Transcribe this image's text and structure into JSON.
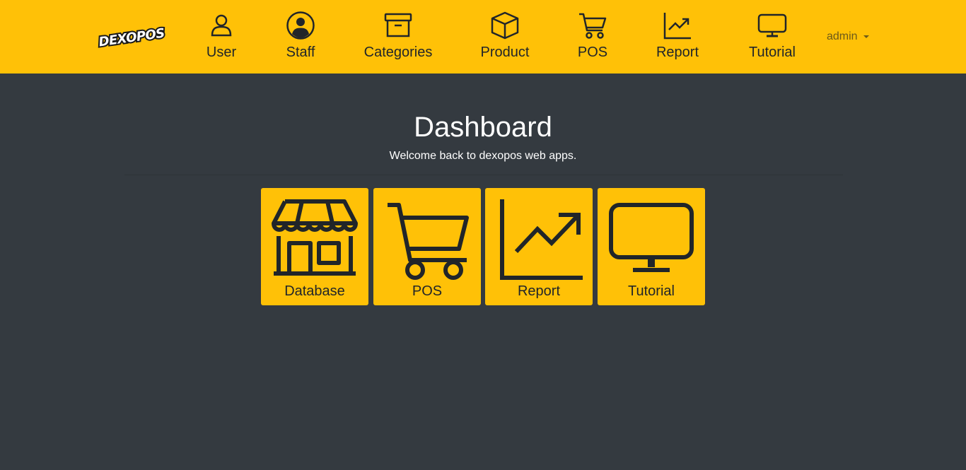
{
  "brand": {
    "logo_text": "DEXOPOS"
  },
  "nav": {
    "items": [
      {
        "label": "User",
        "icon": "user-icon"
      },
      {
        "label": "Staff",
        "icon": "staff-circle-icon"
      },
      {
        "label": "Categories",
        "icon": "archive-box-icon"
      },
      {
        "label": "Product",
        "icon": "box-cube-icon"
      },
      {
        "label": "POS",
        "icon": "cart-icon"
      },
      {
        "label": "Report",
        "icon": "chart-trend-icon"
      },
      {
        "label": "Tutorial",
        "icon": "monitor-icon"
      }
    ],
    "user_menu": "admin"
  },
  "main": {
    "title": "Dashboard",
    "subtitle": "Welcome back to dexopos web apps.",
    "tiles": [
      {
        "label": "Database",
        "icon": "store-icon"
      },
      {
        "label": "POS",
        "icon": "cart-icon"
      },
      {
        "label": "Report",
        "icon": "chart-trend-icon"
      },
      {
        "label": "Tutorial",
        "icon": "monitor-icon"
      }
    ]
  },
  "colors": {
    "accent": "#ffc107",
    "background": "#343a40",
    "icon": "#212529"
  }
}
